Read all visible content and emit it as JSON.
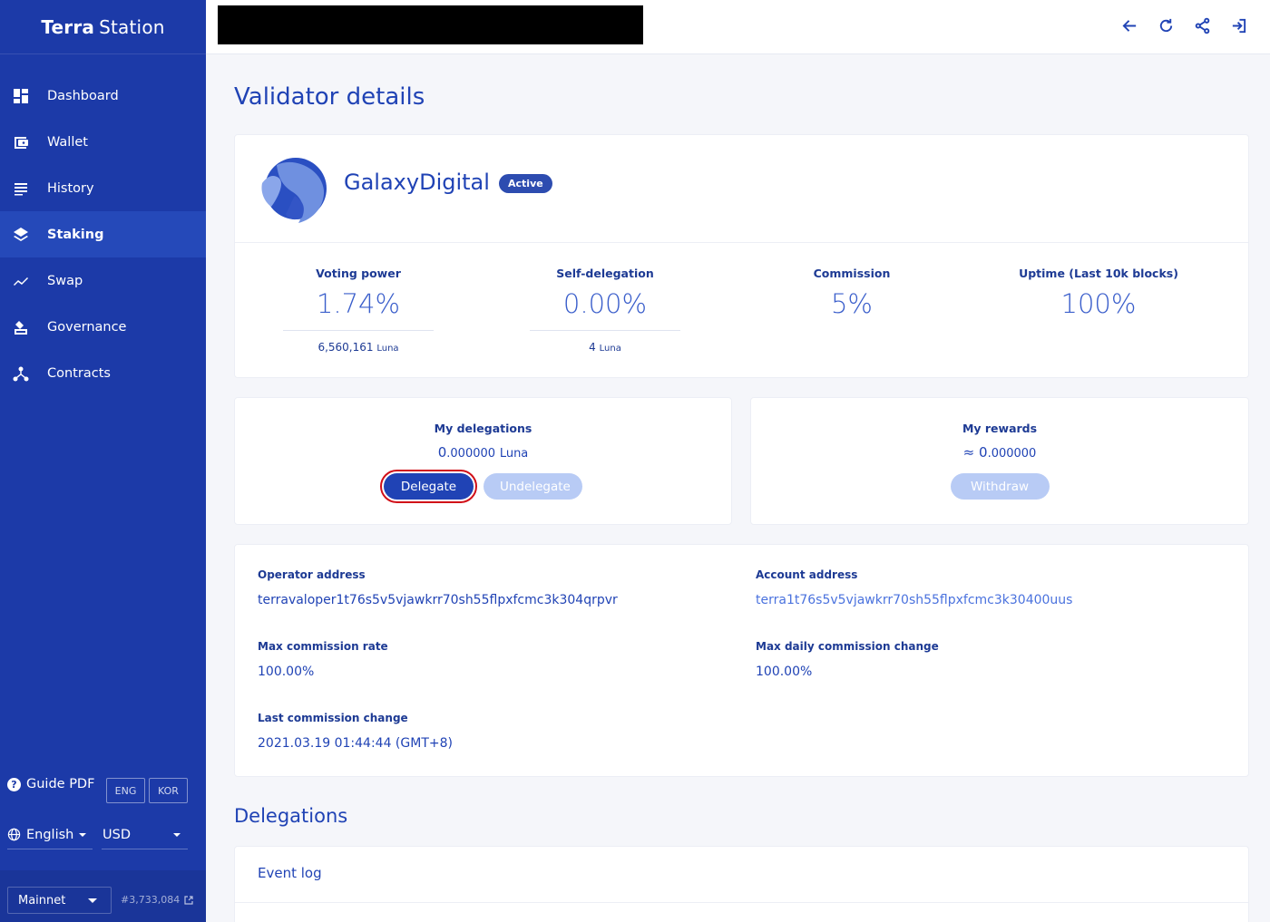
{
  "app": {
    "brand_bold": "Terra",
    "brand_light": "Station"
  },
  "sidebar": {
    "items": [
      {
        "label": "Dashboard",
        "icon": "dashboard-icon"
      },
      {
        "label": "Wallet",
        "icon": "wallet-icon"
      },
      {
        "label": "History",
        "icon": "history-icon"
      },
      {
        "label": "Staking",
        "icon": "staking-icon",
        "active": true
      },
      {
        "label": "Swap",
        "icon": "swap-icon"
      },
      {
        "label": "Governance",
        "icon": "governance-icon"
      },
      {
        "label": "Contracts",
        "icon": "contracts-icon"
      }
    ],
    "guide_label": "Guide PDF",
    "lang_eng": "ENG",
    "lang_kor": "KOR",
    "language": "English",
    "currency": "USD",
    "network": "Mainnet",
    "block_height": "#3,733,084"
  },
  "page": {
    "title": "Validator details"
  },
  "validator": {
    "name": "GalaxyDigital",
    "status": "Active",
    "stats": [
      {
        "label": "Voting power",
        "value": "1.74%",
        "sub": "6,560,161",
        "sub_unit": "Luna"
      },
      {
        "label": "Self-delegation",
        "value": "0.00%",
        "sub": "4",
        "sub_unit": "Luna"
      },
      {
        "label": "Commission",
        "value": "5%"
      },
      {
        "label": "Uptime (Last 10k blocks)",
        "value": "100%"
      }
    ]
  },
  "delegations": {
    "label": "My delegations",
    "value_int": "0",
    "value_frac": ".000000",
    "unit": "Luna",
    "delegate_label": "Delegate",
    "undelegate_label": "Undelegate"
  },
  "rewards": {
    "label": "My rewards",
    "approx": "≈",
    "value_int": "0",
    "value_frac": ".000000",
    "withdraw_label": "Withdraw"
  },
  "info": {
    "operator_label": "Operator address",
    "operator_value": "terravaloper1t76s5v5vjawkrr70sh55flpxfcmc3k304qrpvr",
    "account_label": "Account address",
    "account_value": "terra1t76s5v5vjawkrr70sh55flpxfcmc3k30400uus",
    "max_rate_label": "Max commission rate",
    "max_rate_value": "100.00%",
    "max_change_label": "Max daily commission change",
    "max_change_value": "100.00%",
    "last_change_label": "Last commission change",
    "last_change_value": "2021.03.19 01:44:44 (GMT+8)"
  },
  "delegations_section": {
    "title": "Delegations",
    "event_log_label": "Event log"
  },
  "colors": {
    "sidebar": "#1c3aa8",
    "primary": "#2043b5",
    "highlight": "#d10f18",
    "disabled": "#b8cbf5"
  }
}
